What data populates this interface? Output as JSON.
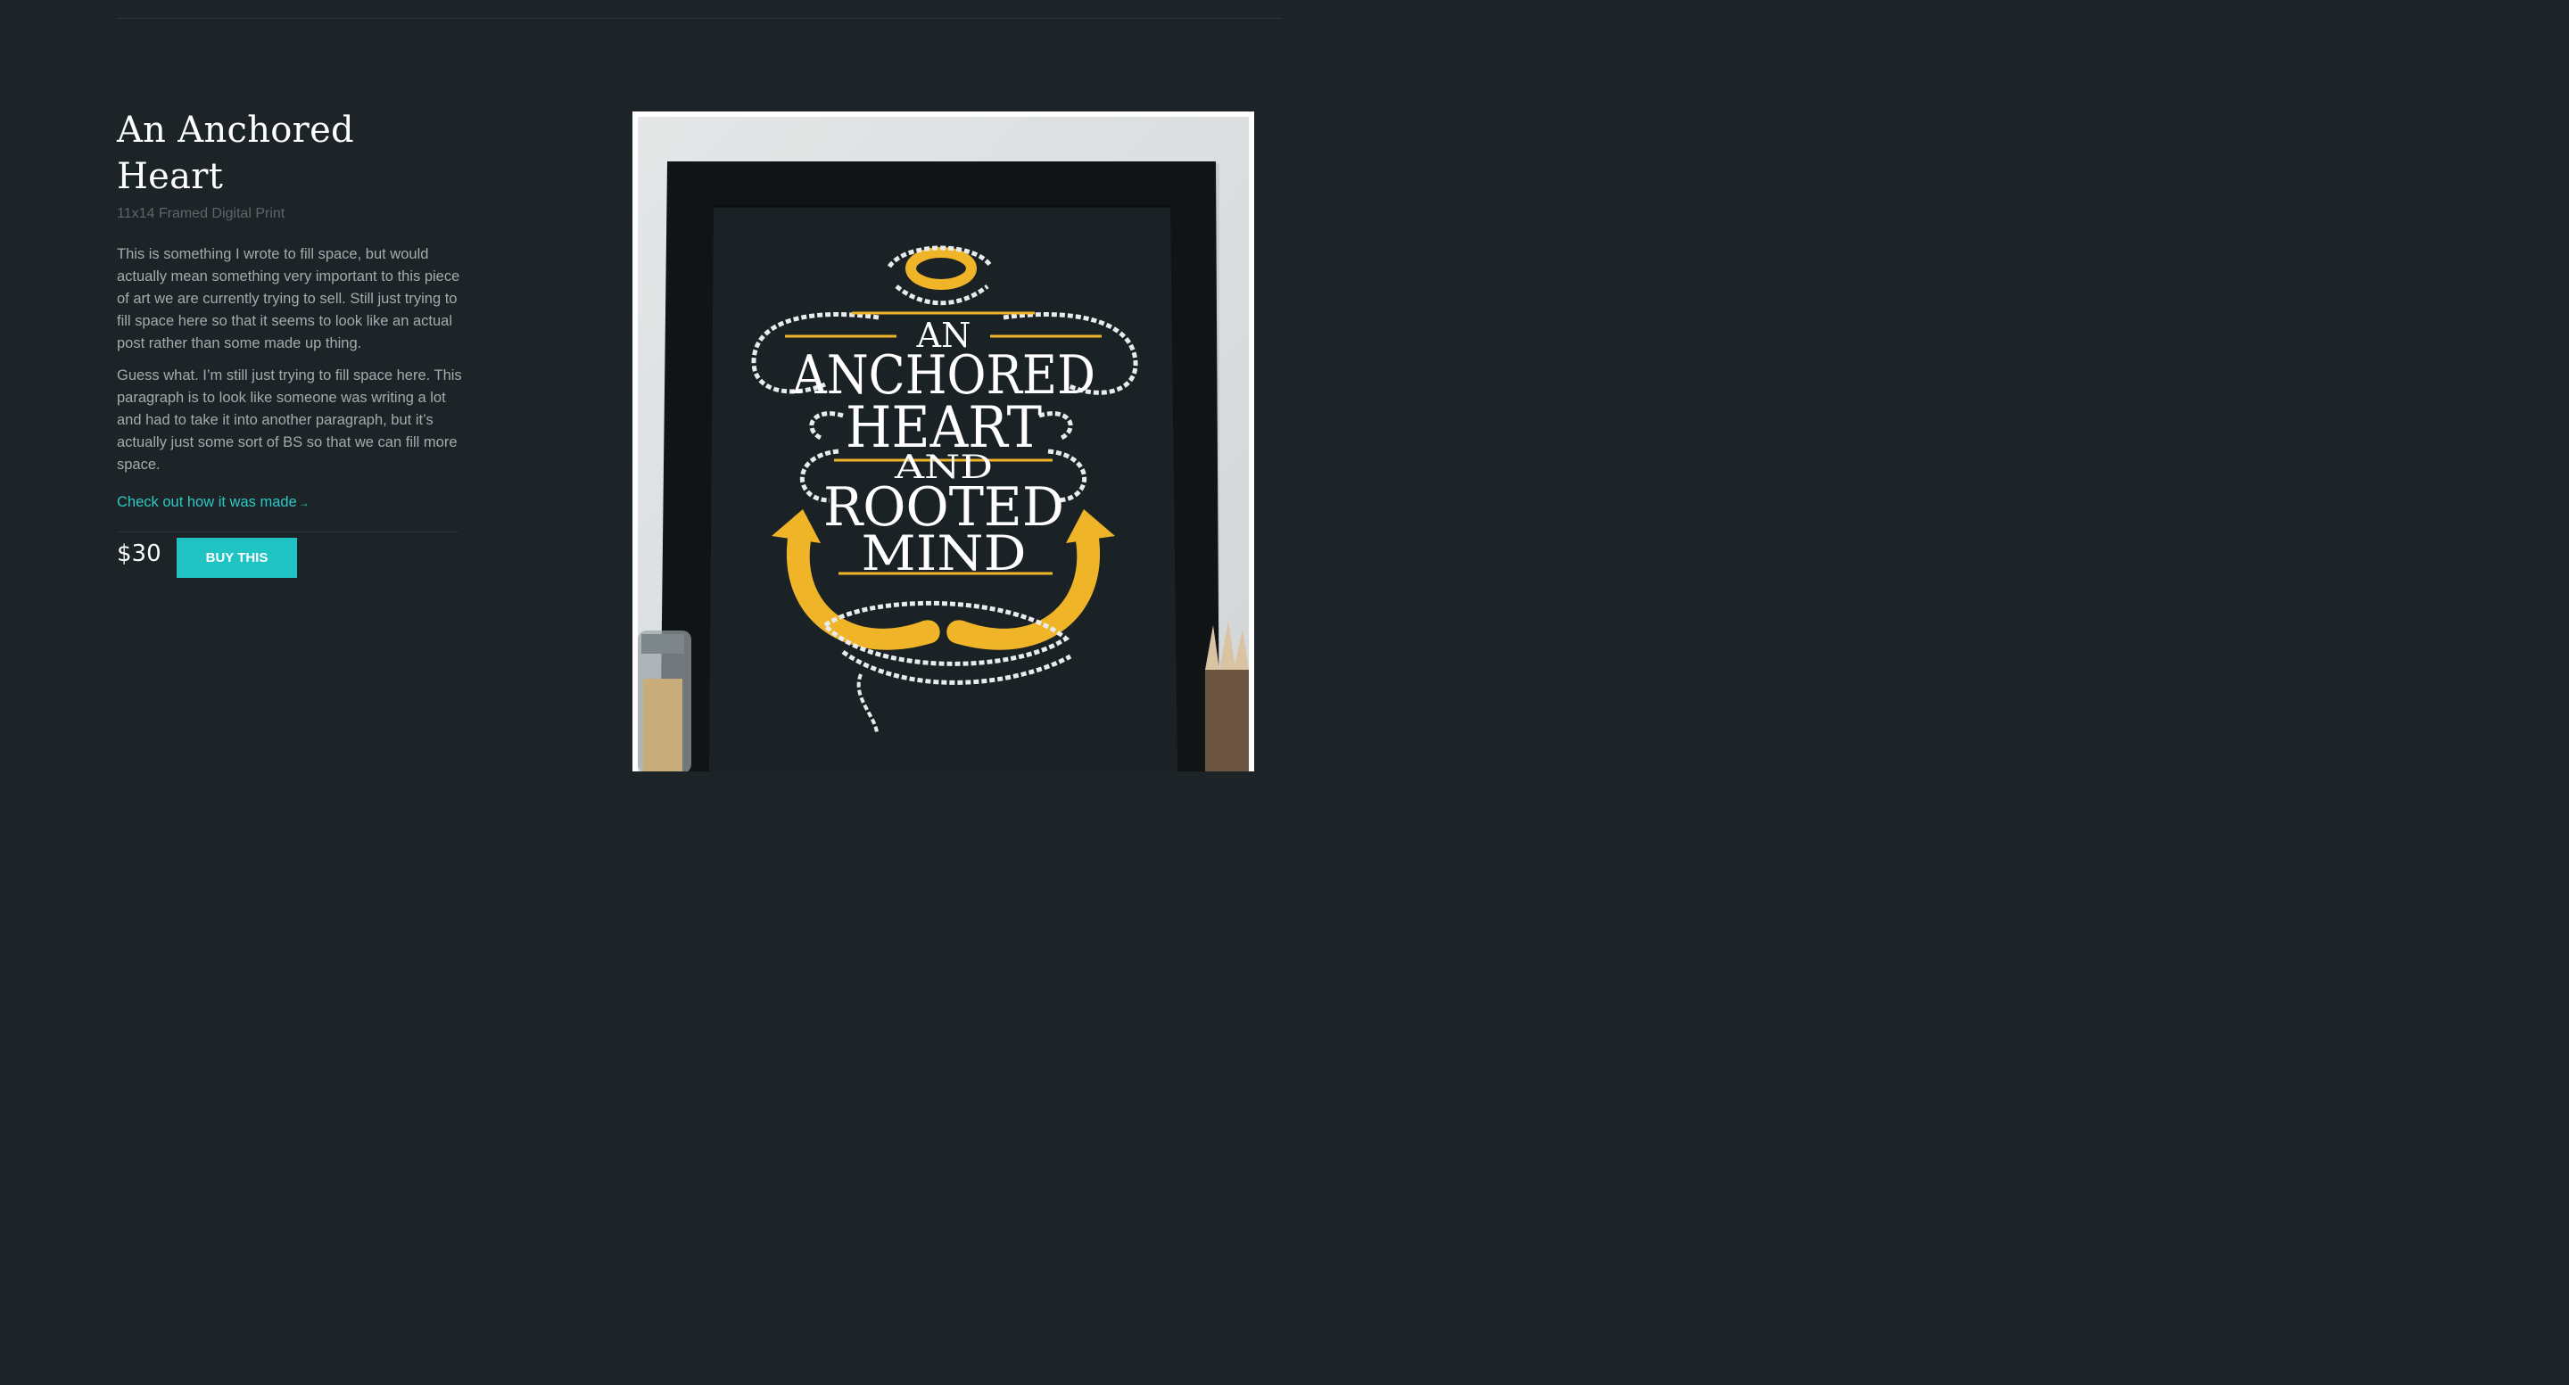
{
  "product": {
    "title": "An Anchored Heart",
    "subtitle": "11x14 Framed Digital Print",
    "description": [
      "This is something I wrote to fill space, but would actually mean something very important to this piece of art we are currently trying to sell. Still just trying to fill space here so that it seems to look like an actual post rather than some made up thing.",
      "Guess what. I’m still just trying to fill space here. This paragraph is to look like someone was writing a lot and had to take it into another paragraph, but it’s actually just some sort of BS so that we can fill more space."
    ],
    "link_label": "Check out how it was made",
    "link_arrow": "→",
    "price": "$30",
    "buy_label": "BUY THIS"
  },
  "artwork": {
    "lines": [
      "AN",
      "ANCHORED",
      "HEART",
      "AND",
      "ROOTED",
      "MIND"
    ]
  },
  "colors": {
    "background": "#1c2427",
    "accent": "#1fc3c4",
    "link": "#2ec9c6",
    "poster_gold": "#f0b429"
  }
}
